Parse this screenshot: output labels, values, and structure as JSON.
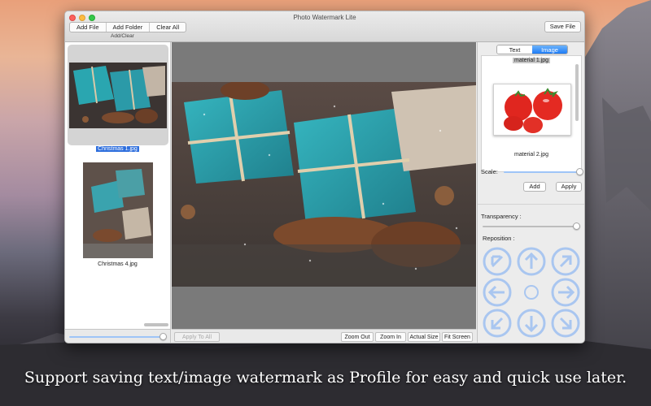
{
  "window": {
    "title": "Photo Watermark Lite"
  },
  "toolbar": {
    "add_file": "Add File",
    "add_folder": "Add Folder",
    "clear_all": "Clear All",
    "group_label": "Add/Clear",
    "save_file": "Save File"
  },
  "files": [
    {
      "name": "Christmas 1.jpg",
      "selected": true
    },
    {
      "name": "Christmas 4.jpg",
      "selected": false
    }
  ],
  "bottom": {
    "apply_to_all": "Apply To All",
    "zoom_out": "Zoom Out",
    "zoom_in": "Zoom In",
    "actual_size": "Actual Size",
    "fit_screen": "Fit Screen"
  },
  "watermark_panel": {
    "tabs": [
      {
        "label": "Text",
        "active": false
      },
      {
        "label": "Image",
        "active": true
      }
    ],
    "items": [
      {
        "name": "material 1.jpg"
      },
      {
        "name": "material 2.jpg"
      }
    ],
    "scale_label": "Scale:",
    "scale_value": 1.0,
    "add_label": "Add",
    "apply_label": "Apply",
    "transparency_label": "Transparency :",
    "transparency_value": 1.0,
    "reposition_label": "Reposition :",
    "reposition_buttons": [
      "arrow-up-left-icon",
      "arrow-up-icon",
      "arrow-up-right-icon",
      "arrow-left-icon",
      "center-dot-icon",
      "arrow-right-icon",
      "arrow-down-left-icon",
      "arrow-down-icon",
      "arrow-down-right-icon"
    ]
  },
  "thumb_size_slider_value": 1.0,
  "colors": {
    "accent": "#1e7cf6",
    "selection": "#2f6fdd",
    "arrow": "#a9c6f0"
  },
  "caption": "Support saving text/image watermark as Profile for easy and quick use later."
}
